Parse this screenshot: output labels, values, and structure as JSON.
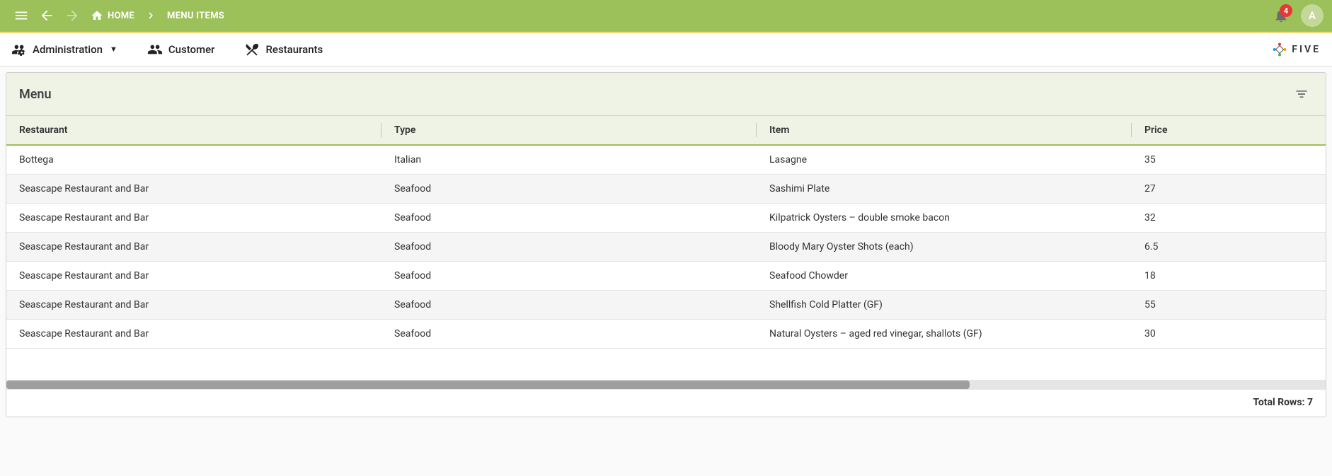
{
  "topbar": {
    "breadcrumb_home": "HOME",
    "breadcrumb_current": "MENU ITEMS",
    "notification_count": "4",
    "avatar_letter": "A"
  },
  "navbar": {
    "admin_label": "Administration",
    "customer_label": "Customer",
    "restaurants_label": "Restaurants",
    "logo_text": "FIVE"
  },
  "panel": {
    "title": "Menu"
  },
  "table": {
    "columns": {
      "restaurant": "Restaurant",
      "type": "Type",
      "item": "Item",
      "price": "Price"
    },
    "rows": [
      {
        "restaurant": "Bottega",
        "type": "Italian",
        "item": "Lasagne",
        "price": "35"
      },
      {
        "restaurant": "Seascape Restaurant and Bar",
        "type": "Seafood",
        "item": "Sashimi Plate",
        "price": "27"
      },
      {
        "restaurant": "Seascape Restaurant and Bar",
        "type": "Seafood",
        "item": "Kilpatrick Oysters – double smoke bacon",
        "price": "32"
      },
      {
        "restaurant": "Seascape Restaurant and Bar",
        "type": "Seafood",
        "item": "Bloody Mary Oyster Shots (each)",
        "price": "6.5"
      },
      {
        "restaurant": "Seascape Restaurant and Bar",
        "type": "Seafood",
        "item": "Seafood Chowder",
        "price": "18"
      },
      {
        "restaurant": "Seascape Restaurant and Bar",
        "type": "Seafood",
        "item": "Shellfish Cold Platter (GF)",
        "price": "55"
      },
      {
        "restaurant": "Seascape Restaurant and Bar",
        "type": "Seafood",
        "item": "Natural Oysters – aged red vinegar, shallots (GF)",
        "price": "30"
      }
    ]
  },
  "footer": {
    "total_rows_label": "Total Rows:",
    "total_rows_value": "7"
  }
}
